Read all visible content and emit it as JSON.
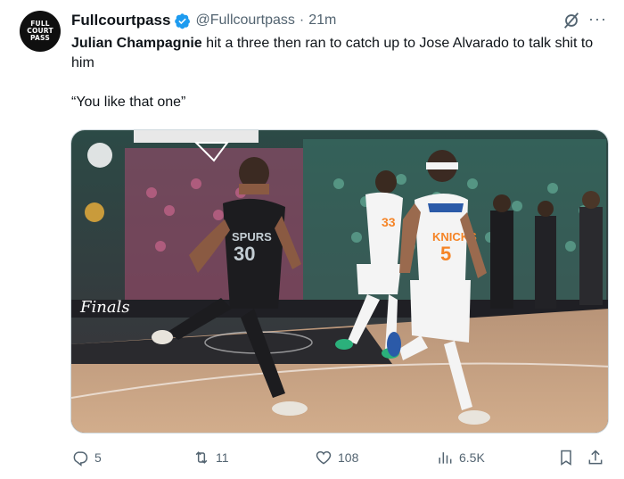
{
  "tweet": {
    "avatar_lines": [
      "FULL",
      "COURT",
      "PASS"
    ],
    "display_name": "Fullcourtpass",
    "handle": "@Fullcourtpass",
    "separator": "·",
    "timestamp": "21m",
    "verified": true,
    "text_name": "Julian Champagnie",
    "text_rest": " hit a three then ran to catch up to Jose Alvarado to talk shit to him",
    "quote": "“You like that one”",
    "more_label": "···",
    "media": {
      "corner_text": "Finals",
      "spurs_jersey_name": "SPURS",
      "spurs_jersey_number": "30",
      "knicks_jersey_name": "KNICKS",
      "knicks_jersey_number": "5",
      "knicks_back_number": "33"
    },
    "actions": {
      "replies": "5",
      "reposts": "11",
      "likes": "108",
      "views": "6.5K"
    },
    "colors": {
      "verified": "#1d9bf0",
      "secondary_text": "#536471",
      "court": "#c9a07e",
      "knicks_orange": "#f58426",
      "knicks_blue": "#2b5aa8"
    }
  }
}
